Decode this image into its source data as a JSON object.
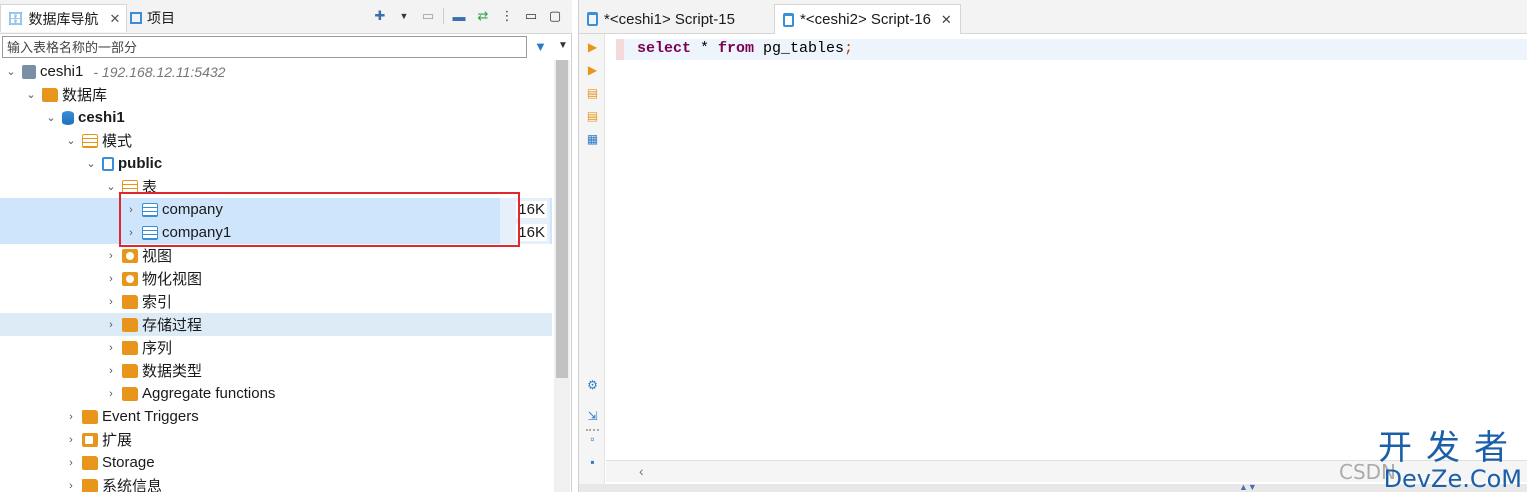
{
  "left_tabs": [
    {
      "label": "数据库导航",
      "close": "✕"
    },
    {
      "label": "项目"
    }
  ],
  "filter": {
    "placeholder": "输入表格名称的一部分"
  },
  "tree": {
    "connection": {
      "label": "ceshi1",
      "host": "- 192.168.12.11:5432"
    },
    "databases": "数据库",
    "db": "ceshi1",
    "schemas": "模式",
    "schema": "public",
    "tables": "表",
    "table_rows": [
      {
        "name": "company",
        "size": "16K"
      },
      {
        "name": "company1",
        "size": "16K"
      }
    ],
    "schema_children": [
      "视图",
      "物化视图",
      "索引",
      "存储过程",
      "序列",
      "数据类型",
      "Aggregate functions"
    ],
    "db_children": [
      "Event Triggers",
      "扩展",
      "Storage",
      "系统信息"
    ]
  },
  "editor_tabs": [
    {
      "label": "*<ceshi1> Script-15"
    },
    {
      "label": "*<ceshi2> Script-16",
      "close": "✕"
    }
  ],
  "editor": {
    "kw_select": "select",
    "rest1": " * ",
    "kw_from": "from",
    "rest2": " pg_tables",
    "semi": ";"
  },
  "watermark": {
    "cn": "开发者",
    "en": "DevZe.CoM",
    "csdn": "CSDN"
  },
  "icons": {
    "nav": "database-navigator-icon",
    "project": "project-icon",
    "filter": "filter-icon"
  }
}
